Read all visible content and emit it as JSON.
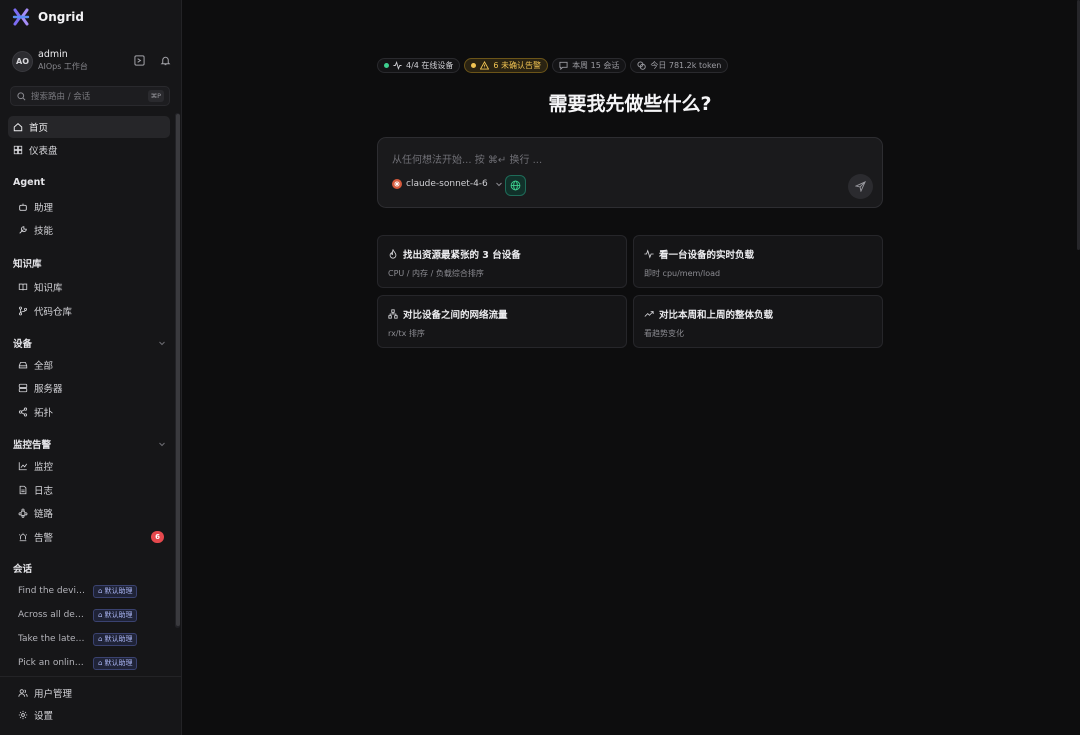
{
  "brand": {
    "name": "Ongrid"
  },
  "user": {
    "initials": "AO",
    "name": "admin",
    "role": "AIOps 工作台"
  },
  "search": {
    "placeholder": "搜索路由 / 会话",
    "shortcut": "⌘P"
  },
  "nav": {
    "home": "首页",
    "dashboard": "仪表盘",
    "agent_section": "Agent",
    "assistant": "助理",
    "skills": "技能",
    "kb_section": "知识库",
    "knowledge_base": "知识库",
    "code_repo": "代码仓库",
    "devices_section": "设备",
    "all": "全部",
    "servers": "服务器",
    "topology": "拓扑",
    "monitoring_section": "监控告警",
    "monitor": "监控",
    "logs": "日志",
    "traces": "链路",
    "alerts": "告警",
    "alerts_count": "6",
    "conversations_section": "会话",
    "user_management": "用户管理",
    "settings": "设置"
  },
  "conversations": [
    {
      "title": "Find the devic...",
      "tag": "默认助理"
    },
    {
      "title": "Across all dev...",
      "tag": "默认助理"
    },
    {
      "title": "Take the lates...",
      "tag": "默认助理"
    },
    {
      "title": "Pick an online...",
      "tag": "默认助理"
    }
  ],
  "status": {
    "online": "4/4 在线设备",
    "alerts": "6 未确认告警",
    "sessions": "本周 15 会话",
    "tokens": "今日 781.2k token"
  },
  "headline": "需要我先做些什么?",
  "composer": {
    "placeholder": "从任何想法开始... 按 ⌘↵ 换行 ...",
    "model": "claude-sonnet-4-6"
  },
  "suggestions": [
    {
      "title": "找出资源最紧张的 3 台设备",
      "subtitle": "CPU / 内存 / 负载综合排序"
    },
    {
      "title": "看一台设备的实时负载",
      "subtitle": "即时 cpu/mem/load"
    },
    {
      "title": "对比设备之间的网络流量",
      "subtitle": "rx/tx 排序"
    },
    {
      "title": "对比本周和上周的整体负载",
      "subtitle": "看趋势变化"
    }
  ],
  "colors": {
    "online": "#3ecf8e",
    "warning": "#f1c453",
    "badge": "#e5484d",
    "accent": "#3ecf8e"
  }
}
